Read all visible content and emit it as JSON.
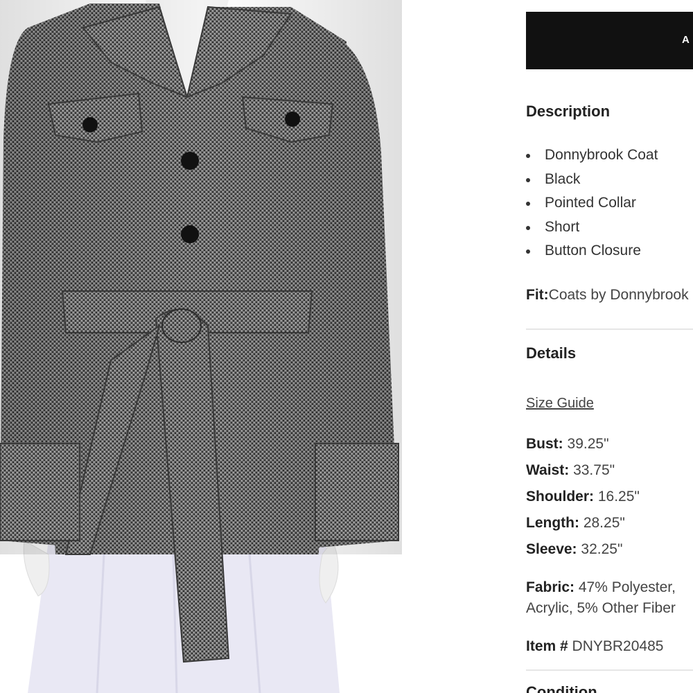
{
  "cart": {
    "button_label": "A"
  },
  "description": {
    "heading": "Description",
    "items": [
      "Donnybrook Coat",
      "Black",
      "Pointed Collar",
      "Short",
      "Button Closure"
    ],
    "fit_label": "Fit:",
    "fit_value": "Coats by Donnybrook"
  },
  "details": {
    "heading": "Details",
    "size_guide": "Size Guide",
    "measurements": [
      {
        "label": "Bust:",
        "value": "39.25\""
      },
      {
        "label": "Waist:",
        "value": "33.75\""
      },
      {
        "label": "Shoulder:",
        "value": "16.25\""
      },
      {
        "label": "Length:",
        "value": "28.25\""
      },
      {
        "label": "Sleeve:",
        "value": "32.25\""
      }
    ],
    "fabric_label": "Fabric:",
    "fabric_line1": "47% Polyester,",
    "fabric_line2": "Acrylic, 5% Other Fiber",
    "item_label": "Item #",
    "item_value": "DNYBR20485"
  },
  "condition": {
    "heading": "Condition"
  },
  "colors": {
    "button_bg": "#111111",
    "tweed": "#6b6b6b",
    "skirt": "#e9e8f4"
  }
}
